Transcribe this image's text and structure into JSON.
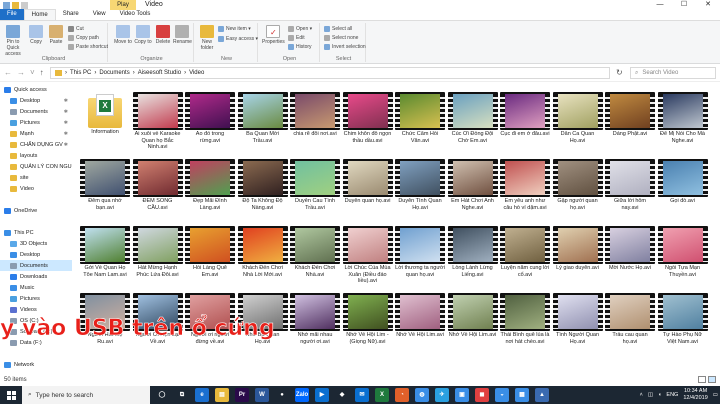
{
  "window": {
    "play_tab": "Play",
    "title": "Video",
    "controls": [
      "—",
      "☐",
      "✕"
    ]
  },
  "tabs": [
    "File",
    "Home",
    "Share",
    "View",
    "Video Tools"
  ],
  "ribbon": {
    "clipboard": {
      "label": "Clipboard",
      "pin": "Pin to Quick access",
      "copy": "Copy",
      "paste": "Paste",
      "cut": "Cut",
      "copy_path": "Copy path",
      "paste_shortcut": "Paste shortcut"
    },
    "organize": {
      "label": "Organize",
      "move_to": "Move to",
      "copy_to": "Copy to",
      "delete": "Delete",
      "rename": "Rename"
    },
    "new": {
      "label": "New",
      "new_folder": "New folder",
      "new_item": "New item ▾",
      "easy_access": "Easy access ▾"
    },
    "open": {
      "label": "Open",
      "properties": "Properties",
      "open": "Open ▾",
      "edit": "Edit",
      "history": "History"
    },
    "select": {
      "label": "Select",
      "select_all": "Select all",
      "select_none": "Select none",
      "invert": "Invert selection"
    }
  },
  "address": {
    "crumbs": [
      "This PC",
      "Documents",
      "Aiseesoft Studio",
      "Video"
    ],
    "search_placeholder": "Search Video"
  },
  "navpane": [
    {
      "label": "Quick access",
      "icon": "star-icon",
      "color": "#2b7de9",
      "pin": false,
      "sel": false
    },
    {
      "label": "Desktop",
      "icon": "desktop-icon",
      "color": "#3a8ee6",
      "pin": true,
      "sel": false
    },
    {
      "label": "Documents",
      "icon": "documents-icon",
      "color": "#8a9bb0",
      "pin": true,
      "sel": false
    },
    {
      "label": "Pictures",
      "icon": "pictures-icon",
      "color": "#4aa0e0",
      "pin": true,
      "sel": false
    },
    {
      "label": "Mạnh",
      "icon": "folder-icon",
      "color": "#e8b93c",
      "pin": true,
      "sel": false
    },
    {
      "label": "CHẤN DỤNG GV",
      "icon": "folder-icon",
      "color": "#e8b93c",
      "pin": true,
      "sel": false
    },
    {
      "label": "layouts",
      "icon": "folder-icon",
      "color": "#e8b93c",
      "pin": false,
      "sel": false
    },
    {
      "label": "QUẢN LÝ CON NGU",
      "icon": "folder-icon",
      "color": "#e8b93c",
      "pin": false,
      "sel": false
    },
    {
      "label": "site",
      "icon": "folder-icon",
      "color": "#e8b93c",
      "pin": false,
      "sel": false
    },
    {
      "label": "Video",
      "icon": "folder-icon",
      "color": "#e8b93c",
      "pin": false,
      "sel": false
    },
    {
      "label": "",
      "icon": "",
      "color": "",
      "pin": false,
      "sel": false
    },
    {
      "label": "OneDrive",
      "icon": "cloud-icon",
      "color": "#2b7de9",
      "pin": false,
      "sel": false
    },
    {
      "label": "",
      "icon": "",
      "color": "",
      "pin": false,
      "sel": false
    },
    {
      "label": "This PC",
      "icon": "computer-icon",
      "color": "#3a8ee6",
      "pin": false,
      "sel": false
    },
    {
      "label": "3D Objects",
      "icon": "3d-objects-icon",
      "color": "#5aa8e8",
      "pin": false,
      "sel": false
    },
    {
      "label": "Desktop",
      "icon": "desktop-icon",
      "color": "#3a8ee6",
      "pin": false,
      "sel": false
    },
    {
      "label": "Documents",
      "icon": "documents-icon",
      "color": "#8a9bb0",
      "pin": false,
      "sel": true
    },
    {
      "label": "Downloads",
      "icon": "downloads-icon",
      "color": "#2b7de9",
      "pin": false,
      "sel": false
    },
    {
      "label": "Music",
      "icon": "music-icon",
      "color": "#3a8ee6",
      "pin": false,
      "sel": false
    },
    {
      "label": "Pictures",
      "icon": "pictures-icon",
      "color": "#4aa0e0",
      "pin": false,
      "sel": false
    },
    {
      "label": "Videos",
      "icon": "videos-icon",
      "color": "#5a70d0",
      "pin": false,
      "sel": false
    },
    {
      "label": "OS (C:)",
      "icon": "drive-icon",
      "color": "#8a9bb0",
      "pin": false,
      "sel": false
    },
    {
      "label": "Software (D:)",
      "icon": "drive-icon",
      "color": "#8a9bb0",
      "pin": false,
      "sel": false
    },
    {
      "label": "Data (F:)",
      "icon": "drive-icon",
      "color": "#8a9bb0",
      "pin": false,
      "sel": false
    },
    {
      "label": "",
      "icon": "",
      "color": "",
      "pin": false,
      "sel": false
    },
    {
      "label": "Network",
      "icon": "network-icon",
      "color": "#3a8ee6",
      "pin": false,
      "sel": false
    }
  ],
  "files": [
    {
      "name": "Information",
      "folder": true,
      "c1": "#f8d775",
      "c2": "#e8b93c"
    },
    {
      "name": "Ai xuôi về Karaoke Quan họ Bắc Ninh.avi",
      "c1": "#e8e2e0",
      "c2": "#c23b4e"
    },
    {
      "name": "Áo đỏ trong rừng.avi",
      "c1": "#b02a8a",
      "c2": "#401050"
    },
    {
      "name": "Ba Quan Mời Trầu.avi",
      "c1": "#a7d4e8",
      "c2": "#6a8a40"
    },
    {
      "name": "chia rẽ đôi nơi.avi",
      "c1": "#7a4a6a",
      "c2": "#c89a70"
    },
    {
      "name": "Chim khôn đỗ ngọn thầu dầu.avi",
      "c1": "#e84a8a",
      "c2": "#803050"
    },
    {
      "name": "Chức Cẩm Hồi Văn.avi",
      "c1": "#5a8a30",
      "c2": "#d8c050"
    },
    {
      "name": "Cúc Ơi Đồng Đội Chờ Em.avi",
      "c1": "#6aa0c0",
      "c2": "#d8e0c0"
    },
    {
      "name": "Cục đi em ở đâu.avi",
      "c1": "#6a2a80",
      "c2": "#e0a0c0"
    },
    {
      "name": "Dân Ca Quan Họ.avi",
      "c1": "#e8e2c0",
      "c2": "#a0a060"
    },
    {
      "name": "Dáng Phật.avi",
      "c1": "#c08a40",
      "c2": "#704020"
    },
    {
      "name": "Để Mị Nói Cho Mà Nghe.avi",
      "c1": "#2a3a60",
      "c2": "#c0c8d0"
    },
    {
      "name": "Đêm qua nhớ bạn.avi",
      "c1": "#a0a8a0",
      "c2": "#405070"
    },
    {
      "name": "ĐÊM SÔNG CẦU.avi",
      "c1": "#d08070",
      "c2": "#702a30"
    },
    {
      "name": "Đẹp Mãi Đình Làng.avi",
      "c1": "#c04060",
      "c2": "#50a050"
    },
    {
      "name": "Độ Ta Không Độ Nàng.avi",
      "c1": "#8a6a50",
      "c2": "#302020"
    },
    {
      "name": "Duyên Cau Tình Trầu.avi",
      "c1": "#70c0a0",
      "c2": "#a0d080"
    },
    {
      "name": "Duyên quan họ.avi",
      "c1": "#e0d8c0",
      "c2": "#9a8a70"
    },
    {
      "name": "Duyên Tình Quan Họ.avi",
      "c1": "#80a0c0",
      "c2": "#405060"
    },
    {
      "name": "Em Hát Chơi Anh Nghe.avi",
      "c1": "#d0c0b0",
      "c2": "#705040"
    },
    {
      "name": "Em yêu anh như câu hò ví dặm.avi",
      "c1": "#c05050",
      "c2": "#f0d0c0"
    },
    {
      "name": "Gặp người quan họ.avi",
      "c1": "#a09080",
      "c2": "#605040"
    },
    {
      "name": "Giữa lời hôm nay.avi",
      "c1": "#e0e0e8",
      "c2": "#b0b0c0"
    },
    {
      "name": "Gọi đò.avi",
      "c1": "#4a80b0",
      "c2": "#90c0e0"
    },
    {
      "name": "Gởi Về Quan Họ Tôe Nam Lam.avi",
      "c1": "#c0e0f0",
      "c2": "#508030"
    },
    {
      "name": "Hát Mừng Hạnh Phúc Lứa Đôi.avi",
      "c1": "#d0d8e0",
      "c2": "#80a060"
    },
    {
      "name": "Hồi Làng Quê Em.avi",
      "c1": "#e8a030",
      "c2": "#d05020"
    },
    {
      "name": "Khách Đến Chơi Nhà Lời Mới.avi",
      "c1": "#e04020",
      "c2": "#f0b040"
    },
    {
      "name": "Khách Đến Chơi Nhà.avi",
      "c1": "#b0c8a0",
      "c2": "#607050"
    },
    {
      "name": "Lời Chúc Của Mùa Xuân (Điều đáo liều).avi",
      "c1": "#f0d0d0",
      "c2": "#c08080"
    },
    {
      "name": "Lời thương ta người quan họ.avi",
      "c1": "#70a0d0",
      "c2": "#d0e0f0"
    },
    {
      "name": "Lòng Lành Lừng Liếng.avi",
      "c1": "#405060",
      "c2": "#a0b0c0"
    },
    {
      "name": "Luyện năm cung lời cổ.avi",
      "c1": "#c0b090",
      "c2": "#706040"
    },
    {
      "name": "Lý giao duyên.avi",
      "c1": "#e0d0b0",
      "c2": "#a07050"
    },
    {
      "name": "Mời Nước Họ.avi",
      "c1": "#d8d0e0",
      "c2": "#8080a0"
    },
    {
      "name": "Ngồi Tựa Mạn Thuyền.avi",
      "c1": "#f0a0b0",
      "c2": "#d05070"
    },
    {
      "name": "Người Hát Mẹ Ru.avi",
      "c1": "#8090a0",
      "c2": "#d0b0a0"
    },
    {
      "name": "Người Ơi Hẹn Lại Về.avi",
      "c1": "#a0c0e0",
      "c2": "#304860"
    },
    {
      "name": "Người ơi người đừng về.avi",
      "c1": "#e0a0a0",
      "c2": "#b05050"
    },
    {
      "name": "Nhớ Ba Quan Họ.avi",
      "c1": "#d0d0d0",
      "c2": "#707070"
    },
    {
      "name": "Nhớ mãi nhau người ơi.avi",
      "c1": "#d0c0e0",
      "c2": "#503060"
    },
    {
      "name": "Nhớ Về Hội Lim - (Giọng Nữ).avi",
      "c1": "#80b050",
      "c2": "#405020"
    },
    {
      "name": "Nhớ Về Hội Lim.avi",
      "c1": "#e0c0d0",
      "c2": "#a06080"
    },
    {
      "name": "Nhớ Về Hội Lim.avi",
      "c1": "#c0d0b0",
      "c2": "#708050"
    },
    {
      "name": "Thái Bình quê lúa là nơi hát chèo.avi",
      "c1": "#506040",
      "c2": "#a0b080"
    },
    {
      "name": "Tình Người Quan Họ.avi",
      "c1": "#e0e0f0",
      "c2": "#9090b0"
    },
    {
      "name": "Trầu cau quan họ.avi",
      "c1": "#e0d0c0",
      "c2": "#b09070"
    },
    {
      "name": "Tự Hào Phụ Nữ Việt Nam.avi",
      "c1": "#a0c0d0",
      "c2": "#5080a0"
    }
  ],
  "overlay_text": "y vào USB trên ổ cứng",
  "status": {
    "count": "50 items"
  },
  "taskbar": {
    "search_placeholder": "Type here to search",
    "apps": [
      {
        "label": "◯",
        "color": "#1c2733"
      },
      {
        "label": "⧉",
        "color": "#1c2733"
      },
      {
        "label": "e",
        "color": "#1a6fd0"
      },
      {
        "label": "▤",
        "color": "#e8b93c"
      },
      {
        "label": "Pr",
        "color": "#2a0a4a"
      },
      {
        "label": "W",
        "color": "#2b579a"
      },
      {
        "label": "●",
        "color": "#1c2733"
      },
      {
        "label": "Zalo",
        "color": "#0068ff"
      },
      {
        "label": "▶",
        "color": "#0a6fd0"
      },
      {
        "label": "◆",
        "color": "#1c2733"
      },
      {
        "label": "✉",
        "color": "#0a6fd0"
      },
      {
        "label": "X",
        "color": "#1f7a3d"
      },
      {
        "label": "◔",
        "color": "#e0602a"
      },
      {
        "label": "◍",
        "color": "#3a8ee6"
      },
      {
        "label": "✈",
        "color": "#2aa0e0"
      },
      {
        "label": "▣",
        "color": "#3a8ee6"
      },
      {
        "label": "◼",
        "color": "#e04040"
      },
      {
        "label": "◒",
        "color": "#3a8ee6"
      },
      {
        "label": "▦",
        "color": "#3a8ee6"
      },
      {
        "label": "▲",
        "color": "#3a6ab0"
      }
    ],
    "lang": "ENG",
    "time": "10:34 AM",
    "date": "12/4/2019"
  }
}
